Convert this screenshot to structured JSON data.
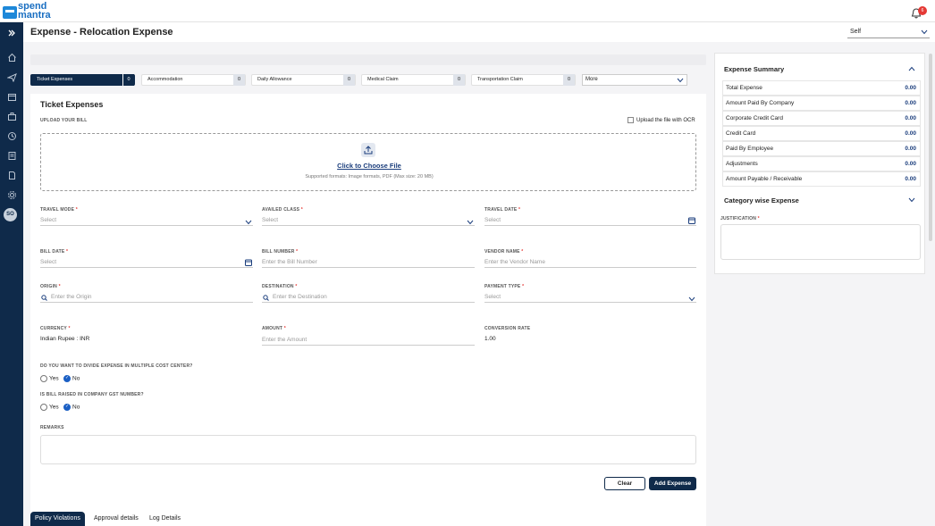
{
  "logo": {
    "line1": "spend",
    "line2": "mantra"
  },
  "notifications": {
    "count": "6"
  },
  "user": {
    "initials": "SO"
  },
  "header": {
    "title": "Expense - Relocation Expense",
    "self_select": "Self"
  },
  "tabs": [
    {
      "label": "Ticket Expenses",
      "count": "0"
    },
    {
      "label": "Accommodation",
      "count": "0"
    },
    {
      "label": "Daily Allowance",
      "count": "0"
    },
    {
      "label": "Medical Claim",
      "count": "0"
    },
    {
      "label": "Transportation Claim",
      "count": "0"
    }
  ],
  "more_label": "More",
  "form": {
    "section_title": "Ticket Expenses",
    "upload_label": "UPLOAD YOUR BILL",
    "ocr_label": "Upload the file with OCR",
    "choose_file": "Click to Choose File",
    "supported": "Supported formats: Image formats, PDF (Max size: 20 MB)",
    "travel_mode": {
      "label": "TRAVEL MODE",
      "value": "Select"
    },
    "availed_class": {
      "label": "AVAILED CLASS",
      "value": "Select"
    },
    "travel_date": {
      "label": "TRAVEL DATE",
      "value": "Select"
    },
    "bill_date": {
      "label": "BILL DATE",
      "value": "Select"
    },
    "bill_number": {
      "label": "BILL NUMBER",
      "placeholder": "Enter the Bill Number"
    },
    "vendor_name": {
      "label": "VENDOR NAME",
      "placeholder": "Enter the Vendor Name"
    },
    "origin": {
      "label": "ORIGIN",
      "placeholder": "Enter the Origin"
    },
    "destination": {
      "label": "DESTINATION",
      "placeholder": "Enter the Destination"
    },
    "payment_type": {
      "label": "PAYMENT TYPE",
      "value": "Select"
    },
    "currency": {
      "label": "CURRENCY",
      "value": "Indian Rupee : INR"
    },
    "amount": {
      "label": "AMOUNT",
      "placeholder": "Enter the Amount"
    },
    "conversion_rate": {
      "label": "CONVERSION RATE",
      "value": "1.00"
    },
    "cost_center_q": "DO YOU WANT TO DIVIDE EXPENSE IN MULTIPLE COST CENTER?",
    "gst_q": "IS BILL RAISED IN COMPANY GST NUMBER?",
    "yes": "Yes",
    "no": "No",
    "remarks_label": "REMARKS",
    "clear": "Clear",
    "add_expense": "Add Expense"
  },
  "bottom_tabs": [
    "Policy Violations",
    "Approval details",
    "Log Details"
  ],
  "summary": {
    "title": "Expense Summary",
    "rows": [
      {
        "label": "Total Expense",
        "value": "0.00"
      },
      {
        "label": "Amount Paid By Company",
        "value": "0.00"
      },
      {
        "label": "Corporate Credit Card",
        "value": "0.00"
      },
      {
        "label": "Credit Card",
        "value": "0.00"
      },
      {
        "label": "Paid By Employee",
        "value": "0.00"
      },
      {
        "label": "Adjustments",
        "value": "0.00"
      },
      {
        "label": "Amount Payable / Receivable",
        "value": "0.00"
      }
    ],
    "category_title": "Category wise Expense",
    "justification_label": "JUSTIFICATION"
  },
  "colors": {
    "navy": "#0f2a4a",
    "accent": "#1a5fc4",
    "required": "#e53935"
  }
}
